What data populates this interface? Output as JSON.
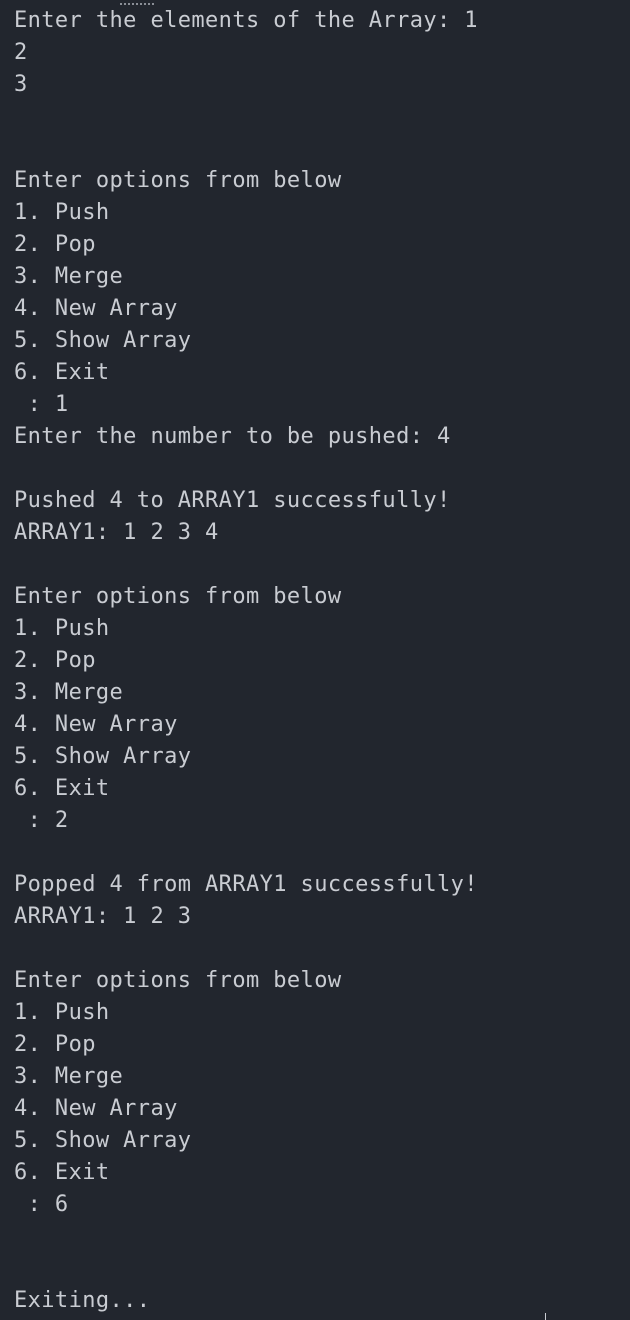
{
  "terminal": {
    "lines": [
      "Enter the elements of the Array: 1",
      "2",
      "3",
      "",
      "",
      "Enter options from below",
      "1. Push",
      "2. Pop",
      "3. Merge",
      "4. New Array",
      "5. Show Array",
      "6. Exit",
      " : 1",
      "Enter the number to be pushed: 4",
      "",
      "Pushed 4 to ARRAY1 successfully!",
      "ARRAY1: 1 2 3 4",
      "",
      "Enter options from below",
      "1. Push",
      "2. Pop",
      "3. Merge",
      "4. New Array",
      "5. Show Array",
      "6. Exit",
      " : 2",
      "",
      "Popped 4 from ARRAY1 successfully!",
      "ARRAY1: 1 2 3",
      "",
      "Enter options from below",
      "1. Push",
      "2. Pop",
      "3. Merge",
      "4. New Array",
      "5. Show Array",
      "6. Exit",
      " : 6",
      "",
      "",
      "Exiting..."
    ]
  }
}
